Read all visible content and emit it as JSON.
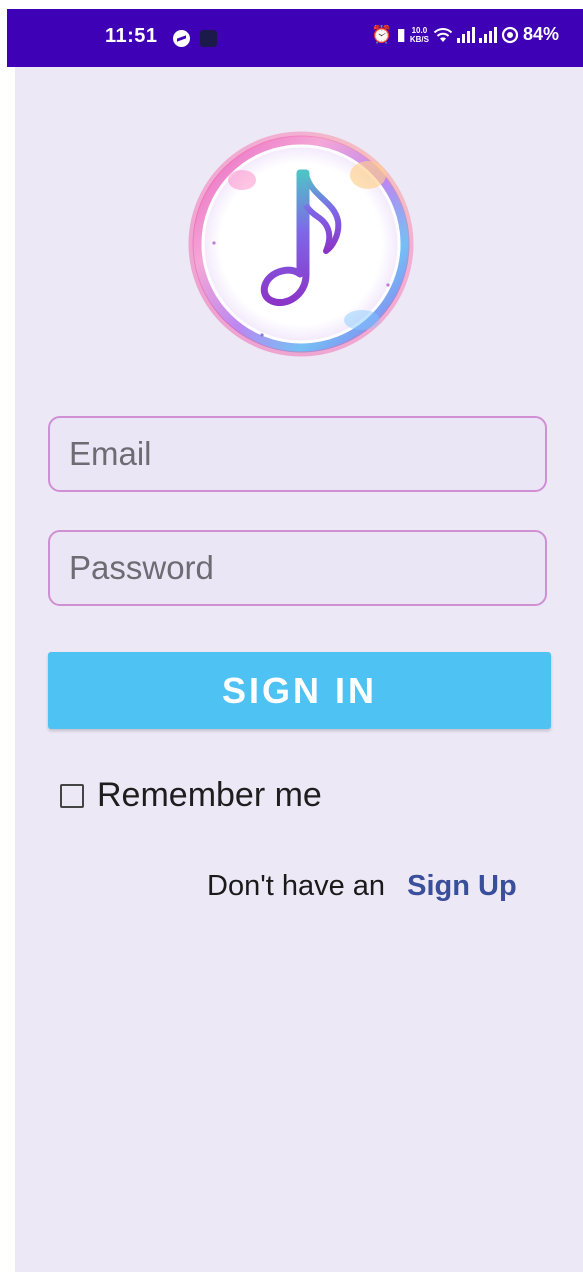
{
  "status_bar": {
    "time": "11:51",
    "battery": "84%",
    "network_speed_value": "10.0",
    "network_speed_unit": "KB/S",
    "icons": [
      "messenger-icon",
      "notification-icon",
      "alarm-icon",
      "vibrate-icon",
      "wifi-icon",
      "signal-icon",
      "signal-icon",
      "battery-saver-icon"
    ],
    "background_color": "#3f01b5"
  },
  "app": {
    "background_color": "#ede8f6",
    "logo": "music-note-icon"
  },
  "login": {
    "email_placeholder": "Email",
    "password_placeholder": "Password",
    "sign_in_label": "SIGN IN",
    "sign_in_color": "#4dc2f3",
    "field_border_color": "#cf8fd3",
    "remember_me_label": "Remember me",
    "remember_me_checked": false,
    "signup_prompt": "Don't have an",
    "signup_link": "Sign Up",
    "signup_link_color": "#3a4f9b"
  }
}
